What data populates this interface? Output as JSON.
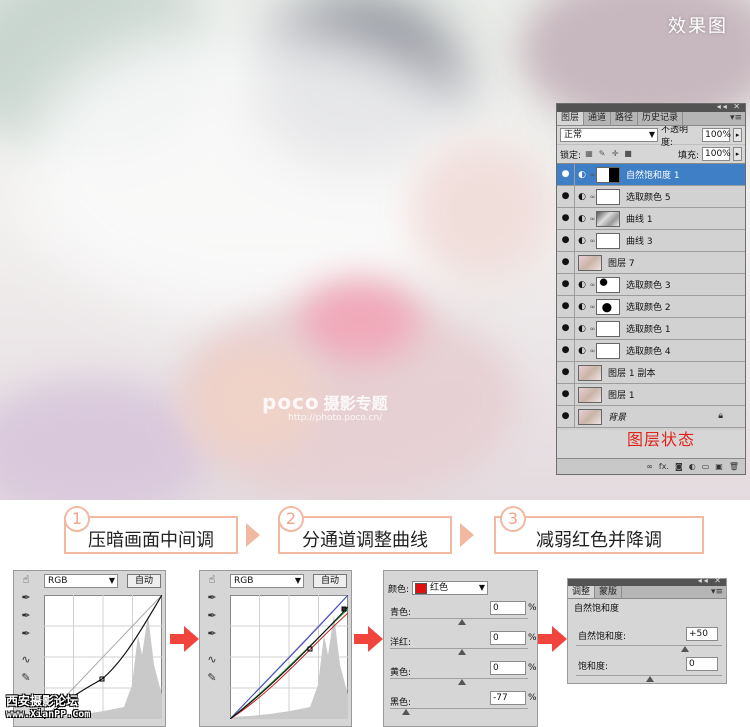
{
  "photo": {
    "caption": "效果图",
    "watermark": {
      "logo": "poco",
      "topic": "摄影专题",
      "url": "http://photo.poco.cn/"
    }
  },
  "layers_panel": {
    "tabs": [
      "图层",
      "通道",
      "路径",
      "历史记录"
    ],
    "blend_mode": "正常",
    "opacity_label": "不透明度:",
    "opacity_value": "100%",
    "lock_label": "锁定:",
    "fill_label": "填充:",
    "fill_value": "100%",
    "layers": [
      {
        "name": "自然饱和度 1"
      },
      {
        "name": "选取颜色 5"
      },
      {
        "name": "曲线 1"
      },
      {
        "name": "曲线 3"
      },
      {
        "name": "图层 7"
      },
      {
        "name": "选取颜色 3"
      },
      {
        "name": "选取颜色 2"
      },
      {
        "name": "选取颜色 1"
      },
      {
        "name": "选取颜色 4"
      },
      {
        "name": "图层 1 副本"
      },
      {
        "name": "图层 1"
      },
      {
        "name": "背景"
      }
    ],
    "status_label": "图层状态"
  },
  "steps": [
    {
      "num": "1",
      "label": "压暗画面中间调"
    },
    {
      "num": "2",
      "label": "分通道调整曲线"
    },
    {
      "num": "3",
      "label": "减弱红色并降调"
    }
  ],
  "curves1": {
    "channel": "RGB",
    "auto_label": "自动"
  },
  "curves2": {
    "channel": "RGB",
    "auto_label": "自动"
  },
  "selective_color": {
    "color_label": "颜色:",
    "color_value": "红色",
    "swatch_color": "#e01010",
    "rows": [
      {
        "label": "青色:",
        "value": "0",
        "unit": "%"
      },
      {
        "label": "洋红:",
        "value": "0",
        "unit": "%"
      },
      {
        "label": "黄色:",
        "value": "0",
        "unit": "%"
      },
      {
        "label": "黑色:",
        "value": "-77",
        "unit": "%"
      }
    ]
  },
  "vibrance": {
    "tabs": [
      "调整",
      "蒙版"
    ],
    "title": "自然饱和度",
    "rows": [
      {
        "label": "自然饱和度:",
        "value": "+50"
      },
      {
        "label": "饱和度:",
        "value": "0"
      }
    ]
  },
  "site_mark": {
    "name": "西安摄影论坛",
    "url": "www.XianPP.Com"
  },
  "colors": {
    "accent_step": "#f2b9a2",
    "arrow_red": "#f0443c",
    "status_red": "#e2231a",
    "selected_layer": "#3e7fc6"
  }
}
